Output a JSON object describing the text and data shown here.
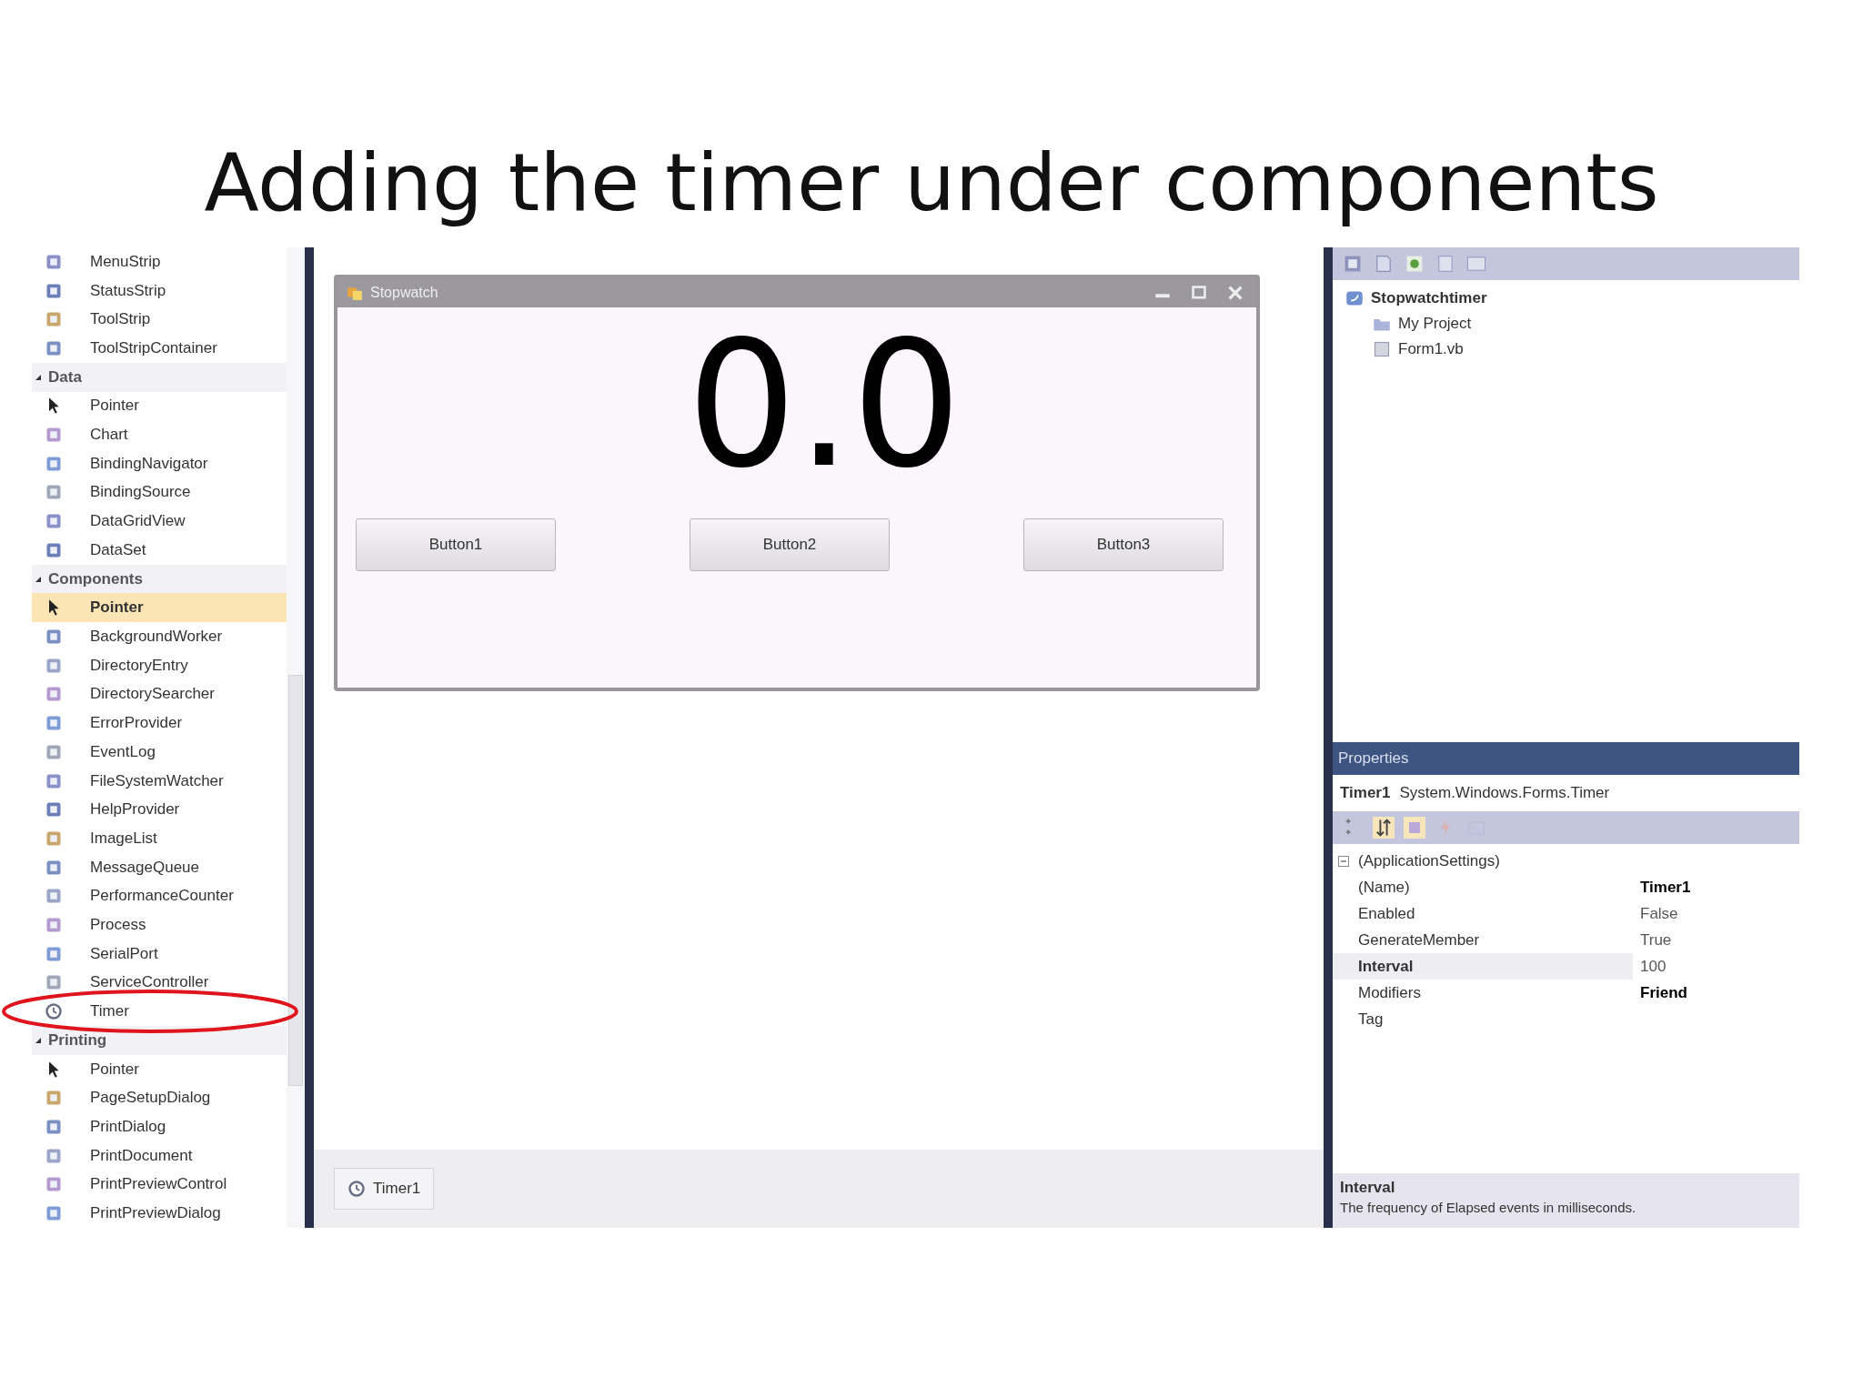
{
  "slide_title": "Adding the timer under components",
  "toolbox": {
    "items": [
      {
        "label": "MenuStrip",
        "kind": "component",
        "selected": false
      },
      {
        "label": "StatusStrip",
        "kind": "component",
        "selected": false
      },
      {
        "label": "ToolStrip",
        "kind": "component",
        "selected": false
      },
      {
        "label": "ToolStripContainer",
        "kind": "component",
        "selected": false
      }
    ],
    "groups": [
      {
        "label": "Data",
        "expanded": true,
        "items": [
          {
            "label": "Pointer",
            "kind": "pointer",
            "selected": false
          },
          {
            "label": "Chart",
            "kind": "component",
            "selected": false
          },
          {
            "label": "BindingNavigator",
            "kind": "component",
            "selected": false
          },
          {
            "label": "BindingSource",
            "kind": "component",
            "selected": false
          },
          {
            "label": "DataGridView",
            "kind": "component",
            "selected": false
          },
          {
            "label": "DataSet",
            "kind": "component",
            "selected": false
          }
        ]
      },
      {
        "label": "Components",
        "expanded": true,
        "items": [
          {
            "label": "Pointer",
            "kind": "pointer",
            "selected": true
          },
          {
            "label": "BackgroundWorker",
            "kind": "component",
            "selected": false
          },
          {
            "label": "DirectoryEntry",
            "kind": "component",
            "selected": false
          },
          {
            "label": "DirectorySearcher",
            "kind": "component",
            "selected": false
          },
          {
            "label": "ErrorProvider",
            "kind": "component",
            "selected": false
          },
          {
            "label": "EventLog",
            "kind": "component",
            "selected": false
          },
          {
            "label": "FileSystemWatcher",
            "kind": "component",
            "selected": false
          },
          {
            "label": "HelpProvider",
            "kind": "component",
            "selected": false
          },
          {
            "label": "ImageList",
            "kind": "component",
            "selected": false
          },
          {
            "label": "MessageQueue",
            "kind": "component",
            "selected": false
          },
          {
            "label": "PerformanceCounter",
            "kind": "component",
            "selected": false
          },
          {
            "label": "Process",
            "kind": "component",
            "selected": false
          },
          {
            "label": "SerialPort",
            "kind": "component",
            "selected": false
          },
          {
            "label": "ServiceController",
            "kind": "component",
            "selected": false
          },
          {
            "label": "Timer",
            "kind": "clock",
            "selected": false,
            "circled": true
          }
        ]
      },
      {
        "label": "Printing",
        "expanded": true,
        "items": [
          {
            "label": "Pointer",
            "kind": "pointer",
            "selected": false
          },
          {
            "label": "PageSetupDialog",
            "kind": "component",
            "selected": false
          },
          {
            "label": "PrintDialog",
            "kind": "component",
            "selected": false
          },
          {
            "label": "PrintDocument",
            "kind": "component",
            "selected": false
          },
          {
            "label": "PrintPreviewControl",
            "kind": "component",
            "selected": false
          },
          {
            "label": "PrintPreviewDialog",
            "kind": "component",
            "selected": false
          }
        ]
      }
    ]
  },
  "form": {
    "title": "Stopwatch",
    "display": "0.0",
    "buttons": [
      "Button1",
      "Button2",
      "Button3"
    ]
  },
  "component_tray": [
    {
      "label": "Timer1"
    }
  ],
  "solution_explorer": {
    "root": {
      "label": "Stopwatchtimer",
      "children": [
        {
          "label": "My Project"
        },
        {
          "label": "Form1.vb"
        }
      ]
    }
  },
  "properties": {
    "title": "Properties",
    "object_name": "Timer1",
    "object_type": "System.Windows.Forms.Timer",
    "category": "(ApplicationSettings)",
    "rows": [
      {
        "name": "(Name)",
        "value": "Timer1",
        "value_bold": true,
        "selected": false
      },
      {
        "name": "Enabled",
        "value": "False",
        "value_bold": false,
        "selected": false
      },
      {
        "name": "GenerateMember",
        "value": "True",
        "value_bold": false,
        "selected": false
      },
      {
        "name": "Interval",
        "value": "100",
        "value_bold": false,
        "selected": true
      },
      {
        "name": "Modifiers",
        "value": "Friend",
        "value_bold": true,
        "selected": false
      },
      {
        "name": "Tag",
        "selected": false
      }
    ],
    "description_title": "Interval",
    "description": "The frequency of Elapsed events in milliseconds."
  }
}
